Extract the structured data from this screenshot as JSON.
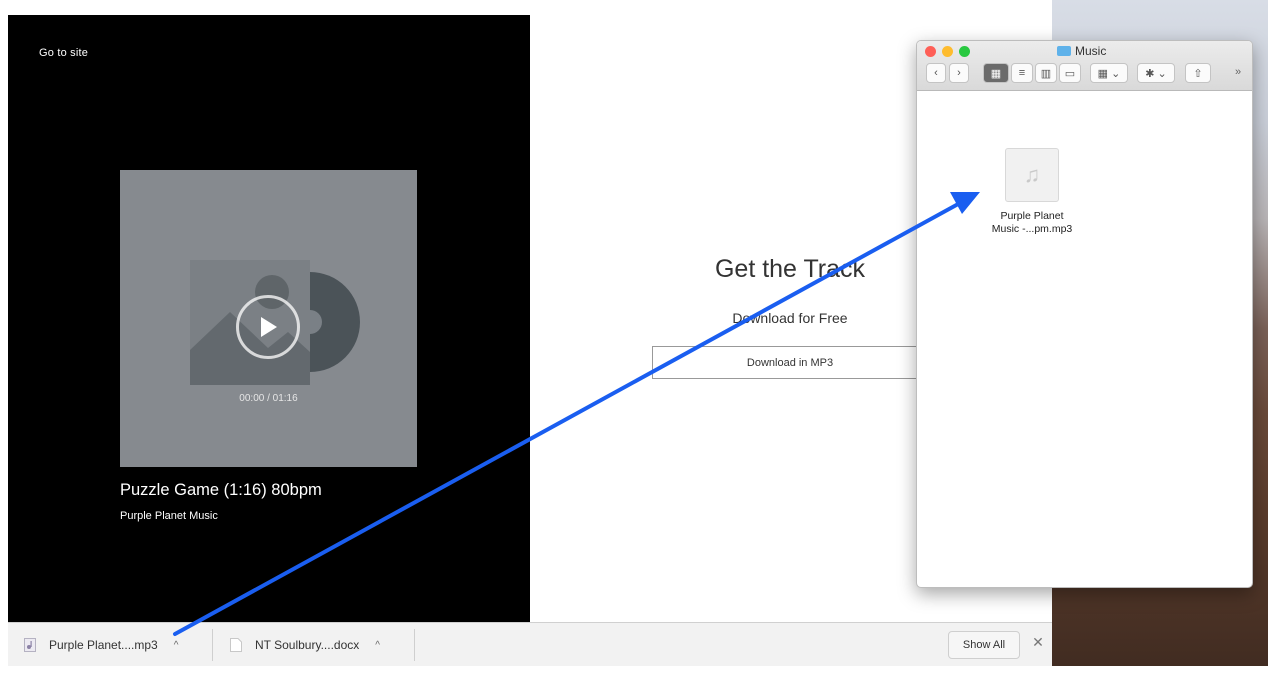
{
  "player": {
    "go_to_site": "Go to site",
    "time": "00:00 / 01:16",
    "track_title": "Puzzle Game (1:16) 80bpm",
    "artist": "Purple Planet Music"
  },
  "download": {
    "title": "Get the Track",
    "subtitle": "Download for Free",
    "button_label": "Download in MP3"
  },
  "downloads_bar": {
    "items": [
      {
        "name": "Purple Planet....mp3",
        "icon": "audio-file-icon"
      },
      {
        "name": "NT Soulbury....docx",
        "icon": "document-file-icon"
      }
    ],
    "show_all": "Show All",
    "close": "✕"
  },
  "finder": {
    "title": "Music",
    "file_label_line1": "Purple Planet",
    "file_label_line2": "Music -...pm.mp3"
  },
  "colors": {
    "arrow": "#1a5ef0",
    "close": "#fe5f57",
    "minimize": "#febc2e",
    "zoom": "#28c840"
  }
}
